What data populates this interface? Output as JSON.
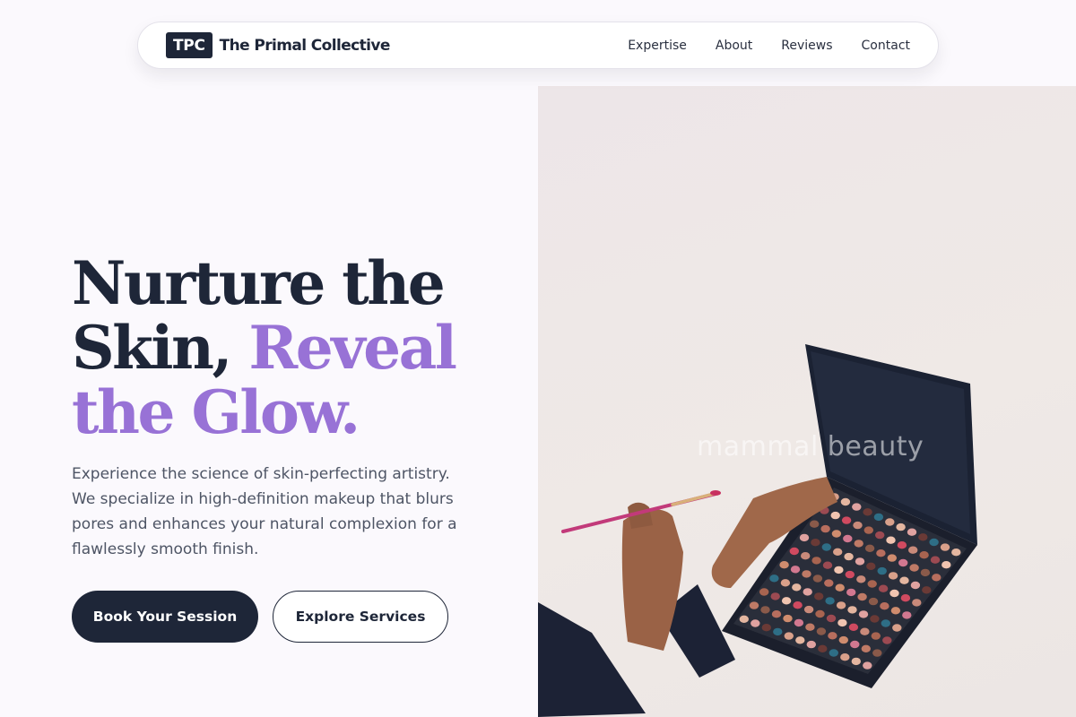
{
  "brand": {
    "mark": "TPC",
    "name": "The Primal Collective"
  },
  "nav": {
    "links": [
      "Expertise",
      "About",
      "Reviews",
      "Contact"
    ]
  },
  "hero": {
    "title_line1": "Nurture the",
    "title_line2_dark": "Skin, ",
    "title_line2_accent": "Reveal",
    "title_line3_accent": "the Glow.",
    "description": "Experience the science of skin-perfecting artistry. We specialize in high-definition makeup that blurs pores and enhances your natural complexion for a flawlessly smooth finish.",
    "cta_primary": "Book Your Session",
    "cta_secondary": "Explore Services",
    "image_watermark": "mammal beauty"
  },
  "colors": {
    "dark": "#1e2638",
    "accent": "#9872d6",
    "background": "#fbf9fd"
  }
}
